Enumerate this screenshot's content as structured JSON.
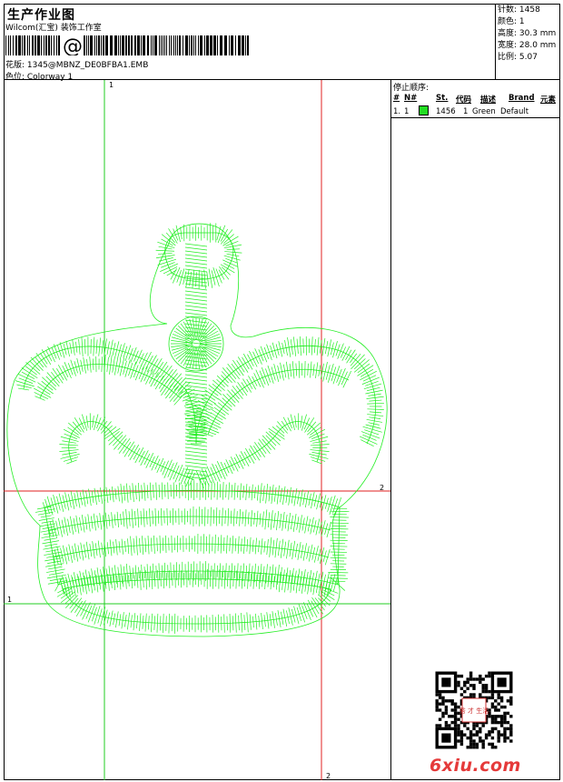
{
  "header": {
    "title": "生产作业图",
    "company": "Wilcom(汇宝) 装饰工作室",
    "design_line": "花版: 1345@MBNZ_DE0BFBA1.EMB",
    "colorway_line": "色位: Colorway 1"
  },
  "stats": [
    "针数: 1458",
    "颜色: 1",
    "高度: 30.3 mm",
    "宽度: 28.0 mm",
    "比例: 5.07"
  ],
  "sequence": {
    "heading": "停止顺序:",
    "columns": [
      "#",
      "N#",
      "St.",
      "代码",
      "描述",
      "Brand",
      "元素"
    ],
    "rows": [
      {
        "index": "1.",
        "n": "1",
        "stitches": "1456",
        "code": "1",
        "desc": "Green",
        "brand": "Default"
      }
    ]
  },
  "guides": {
    "v1": "1",
    "v2": "2",
    "h1": "1",
    "h2": "2"
  },
  "colors": {
    "stitch": "#22ee22",
    "guide_green": "#22cc22",
    "guide_red": "#e02020"
  },
  "watermark": "6xiu.com",
  "qr_badge": "秀 才 生活"
}
